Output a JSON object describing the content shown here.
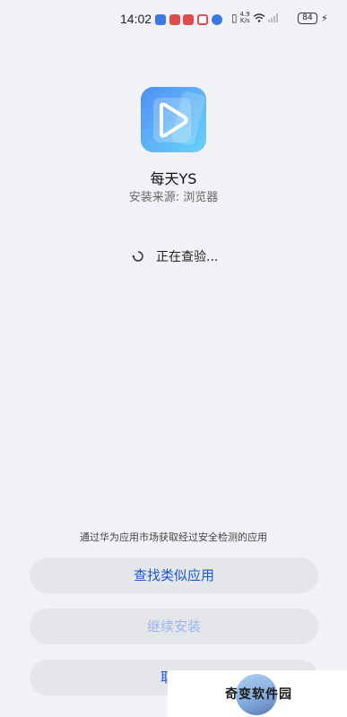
{
  "status_bar": {
    "time": "14:02",
    "net_speed_value": "4.9",
    "net_speed_unit": "K/s",
    "battery": "84",
    "icons": [
      "notif-app-icon",
      "notif-app-icon",
      "notif-app-icon",
      "notif-app-icon",
      "notif-app-icon",
      "vibrate-icon",
      "wifi-icon",
      "signal-icon",
      "battery-icon",
      "charging-icon"
    ]
  },
  "app": {
    "name": "每天YS",
    "source_label": "安装来源:",
    "source_value": "浏览器"
  },
  "checking": {
    "text": "正在查验..."
  },
  "notice": "通过华为应用市场获取经过安全检测的应用",
  "buttons": {
    "find_similar": "查找类似应用",
    "continue_install": "继续安装",
    "cancel": "取消"
  },
  "watermark": {
    "text": "奇变软件园"
  },
  "colors": {
    "accent": "#1b57d6",
    "disabled": "#9ab4ea",
    "background": "#f1f2f5",
    "button_bg": "#e5e6ea"
  }
}
